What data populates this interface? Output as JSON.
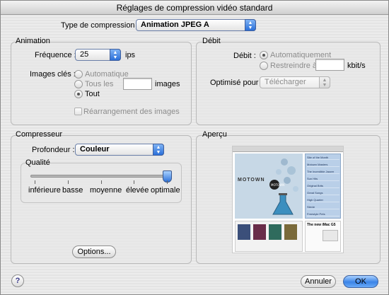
{
  "window": {
    "title": "Réglages de compression vidéo standard"
  },
  "compression": {
    "label": "Type de compression :",
    "value": "Animation JPEG A"
  },
  "animation": {
    "title": "Animation",
    "frequency_label": "Fréquence :",
    "frequency_value": "25",
    "frequency_unit": "ips",
    "keyframes_label": "Images clés :",
    "keyframes_options": [
      "Automatique",
      "Tous les",
      "Tout"
    ],
    "keyframes_selected": "Tout",
    "keyframes_unit": "images",
    "reorder_label": "Réarrangement des images",
    "reorder_checked": false
  },
  "debit": {
    "title": "Débit",
    "label": "Débit :",
    "options": [
      "Automatiquement",
      "Restreindre à"
    ],
    "selected": "Automatiquement",
    "unit": "kbit/s",
    "optimize_label": "Optimisé pour",
    "optimize_value": "Télécharger"
  },
  "compressor": {
    "title": "Compresseur",
    "depth_label": "Profondeur :",
    "depth_value": "Couleur",
    "quality_title": "Qualité",
    "quality_levels": [
      "inférieure",
      "basse",
      "moyenne",
      "élevée",
      "optimale"
    ],
    "quality_selected_fraction": 1.0,
    "options_button": "Options..."
  },
  "preview": {
    "title": "Aperçu",
    "motown_text": "MOTOWN",
    "sidebar_items": [
      "Site of the Month",
      "Motown Masters",
      "The Incredible Jazzer",
      "Sun Hits",
      "Original Brits",
      "Great Songs",
      "High Quarter",
      "Stevie",
      "Freestyle Pets"
    ],
    "promo_text": "The new iMac G5"
  },
  "footer": {
    "help": "?",
    "cancel": "Annuler",
    "ok": "OK"
  },
  "colors": {
    "accent": "#3b84e7",
    "slider": "#2e73da",
    "motown_bg": "#c7d8e6"
  }
}
